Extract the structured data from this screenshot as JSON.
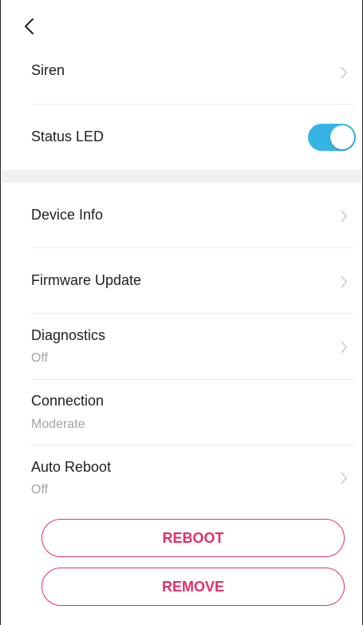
{
  "nav": {
    "back_icon": "chevron-left-icon"
  },
  "settings": {
    "siren": {
      "label": "Siren"
    },
    "status_led": {
      "label": "Status LED",
      "enabled": true,
      "accent": "#36b5e5"
    },
    "device_info": {
      "label": "Device Info"
    },
    "firmware_update": {
      "label": "Firmware Update"
    },
    "diagnostics": {
      "label": "Diagnostics",
      "value": "Off"
    },
    "connection": {
      "label": "Connection",
      "value": "Moderate"
    },
    "auto_reboot": {
      "label": "Auto Reboot",
      "value": "Off"
    }
  },
  "actions": {
    "reboot_label": "REBOOT",
    "remove_label": "REMOVE",
    "accent": "#e0316a"
  }
}
